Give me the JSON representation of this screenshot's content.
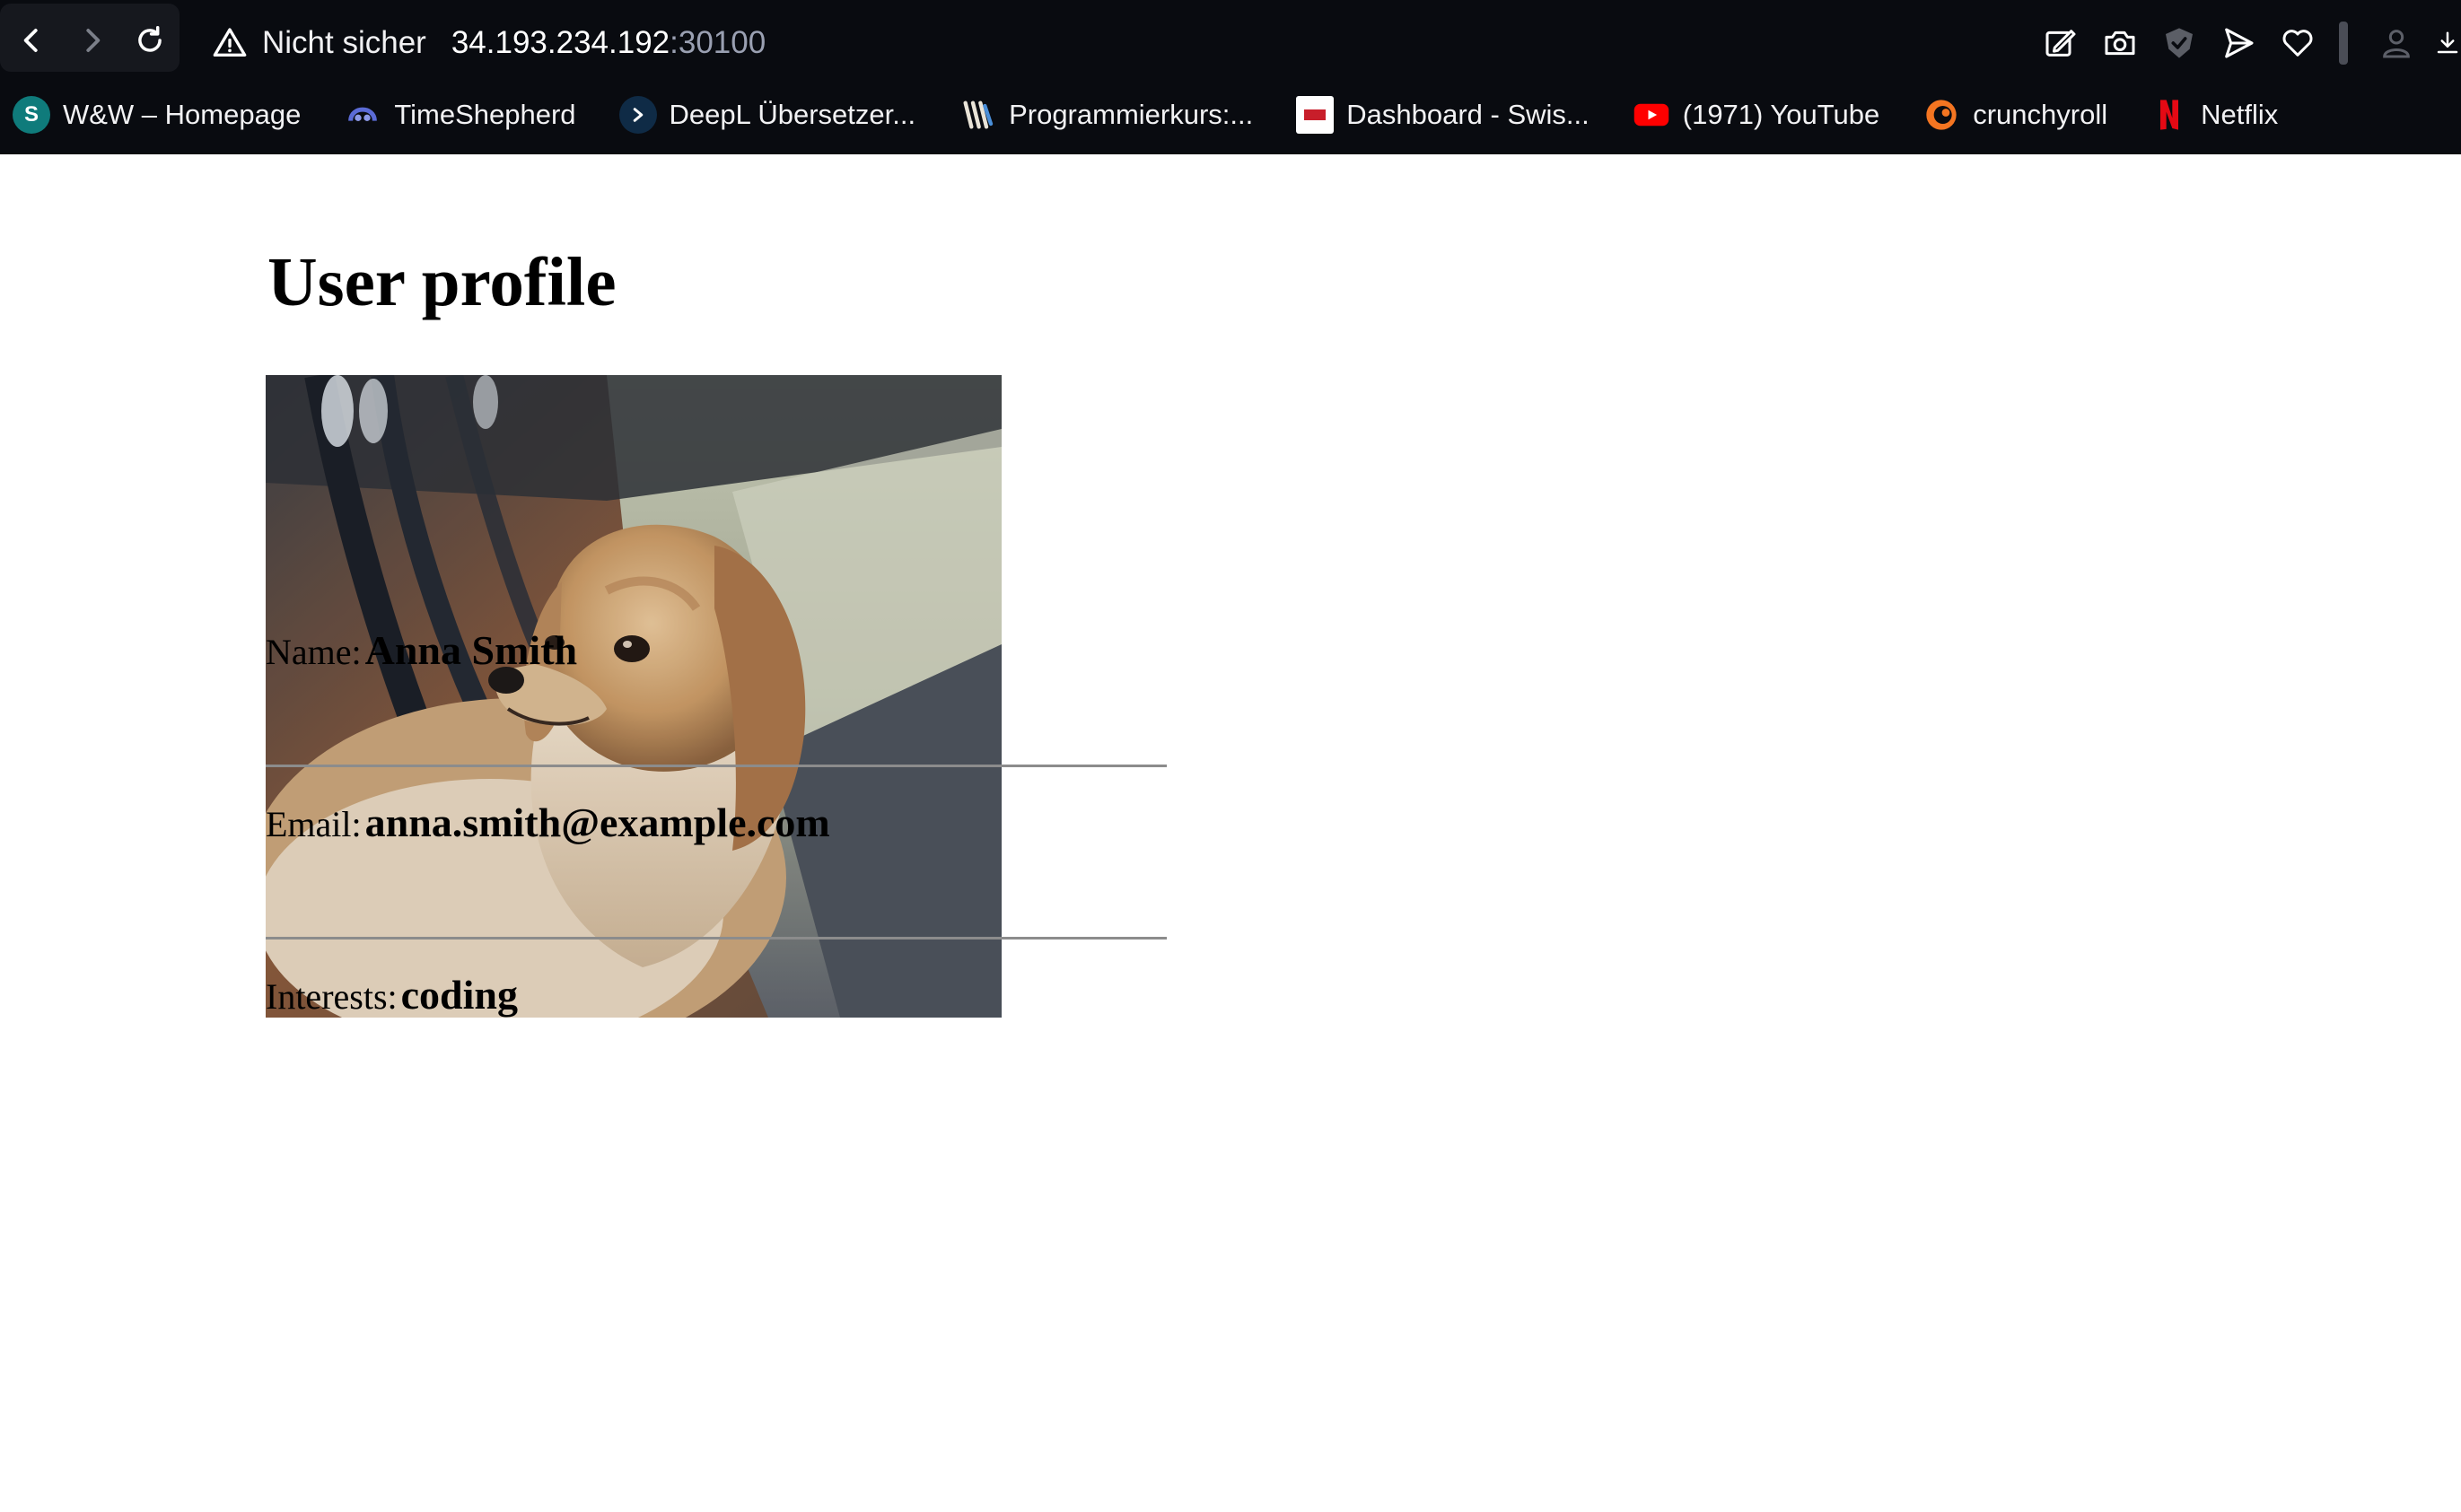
{
  "browser": {
    "address": {
      "security_label": "Nicht sicher",
      "host": "34.193.234.192",
      "port": ":30100"
    },
    "actions": [
      "edit-page-icon",
      "camera-icon",
      "shield-icon",
      "send-icon",
      "heart-icon",
      "profile-icon",
      "download-icon"
    ],
    "bookmarks": [
      {
        "label": "W&W – Homepage",
        "icon": "sharepoint-icon",
        "color": "#0f7b7b"
      },
      {
        "label": "TimeShepherd",
        "icon": "timeshepherd-icon",
        "color": "#3a3f8f"
      },
      {
        "label": "DeepL Übersetzer...",
        "icon": "deepl-icon",
        "color": "#0f2b46"
      },
      {
        "label": "Programmierkurs:...",
        "icon": "programmierkurs-icon",
        "color": "#e9e4d8"
      },
      {
        "label": "Dashboard - Swis...",
        "icon": "dashboard-icon",
        "color": "#ffffff"
      },
      {
        "label": "(1971) YouTube",
        "icon": "youtube-icon",
        "color": "#ff0000"
      },
      {
        "label": "crunchyroll",
        "icon": "crunchyroll-icon",
        "color": "#f47521"
      },
      {
        "label": "Netflix",
        "icon": "netflix-icon",
        "color": "#e50914"
      }
    ]
  },
  "profile": {
    "title": "User profile",
    "photo_alt": "Dog photo",
    "name_label": "Name:",
    "name_value": "Anna Smith",
    "email_label": "Email:",
    "email_value": "anna.smith@example.com",
    "interests_label": "Interests:",
    "interests_value": "coding"
  }
}
